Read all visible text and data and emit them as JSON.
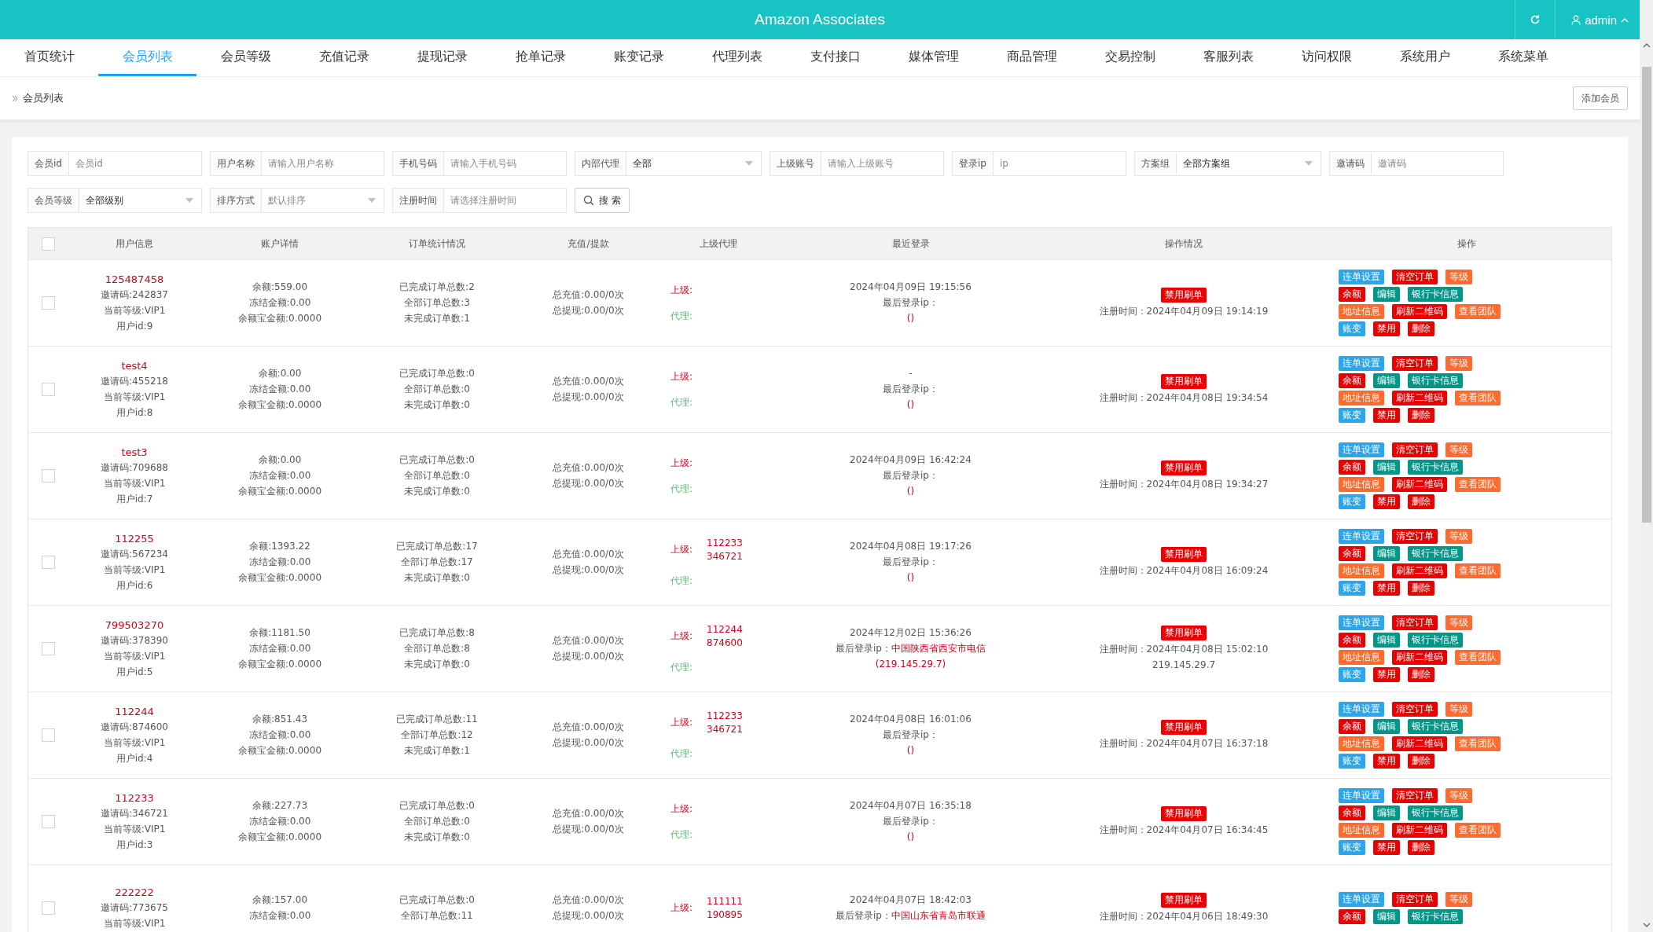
{
  "header": {
    "title": "Amazon Associates",
    "user": "admin"
  },
  "tabs": [
    {
      "label": "首页统计",
      "selected": false
    },
    {
      "label": "会员列表",
      "selected": true
    },
    {
      "label": "会员等级",
      "selected": false
    },
    {
      "label": "充值记录",
      "selected": false
    },
    {
      "label": "提现记录",
      "selected": false
    },
    {
      "label": "抢单记录",
      "selected": false
    },
    {
      "label": "账变记录",
      "selected": false
    },
    {
      "label": "代理列表",
      "selected": false
    },
    {
      "label": "支付接口",
      "selected": false
    },
    {
      "label": "媒体管理",
      "selected": false
    },
    {
      "label": "商品管理",
      "selected": false
    },
    {
      "label": "交易控制",
      "selected": false
    },
    {
      "label": "客服列表",
      "selected": false
    },
    {
      "label": "访问权限",
      "selected": false
    },
    {
      "label": "系统用户",
      "selected": false
    },
    {
      "label": "系统菜单",
      "selected": false
    }
  ],
  "breadcrumb": "会员列表",
  "add_button": "添加会员",
  "filters": [
    {
      "label": "会员id",
      "kind": "input",
      "placeholder": "会员id"
    },
    {
      "label": "用户名称",
      "kind": "input",
      "placeholder": "请输入用户名称"
    },
    {
      "label": "手机号码",
      "kind": "input",
      "placeholder": "请输入手机号码"
    },
    {
      "label": "内部代理",
      "kind": "select",
      "value": "全部"
    },
    {
      "label": "上级账号",
      "kind": "input",
      "placeholder": "请输入上级账号"
    },
    {
      "label": "登录ip",
      "kind": "input",
      "placeholder": "ip"
    },
    {
      "label": "方案组",
      "kind": "select",
      "value": "全部方案组"
    },
    {
      "label": "邀请码",
      "kind": "input",
      "placeholder": "邀请码"
    },
    {
      "label": "会员等级",
      "kind": "select",
      "value": "全部级别"
    },
    {
      "label": "排序方式",
      "kind": "select",
      "placeholder": "默认排序"
    },
    {
      "label": "注册时间",
      "kind": "input",
      "placeholder": "请选择注册时间"
    }
  ],
  "search_button": "搜 索",
  "table": {
    "all_checked": false,
    "columns": [
      "用户信息",
      "账户详情",
      "订单统计情况",
      "充值/提款",
      "上级代理",
      "最近登录",
      "操作情况",
      "操作"
    ],
    "rows": [
      {
        "checked": false,
        "name": "125487458",
        "user_lines": [
          "邀请码:242837",
          "当前等级:VIP1",
          "用户id:9"
        ],
        "account": [
          "余额:559.00",
          "冻结金额:0.00",
          "余额宝金额:0.0000"
        ],
        "orders": [
          "已完成订单总数:2",
          "全部订单总数:3",
          "未完成订单数:1"
        ],
        "funds": [
          "总充值:0.00/0次",
          "总提现:0.00/0次"
        ],
        "superior_label": "上级:",
        "superiors": [],
        "agent_label": "代理:",
        "login_time": "2024年04月09日 19:15:56",
        "ip_label": "最后登录ip：",
        "ip": "()",
        "op_button": "禁用刷单",
        "reg_time": "注册时间：2024年04月09日 19:14:19",
        "actions": [
          [
            {
              "label": "连单设置",
              "kind": "info"
            },
            {
              "label": "清空订单",
              "kind": "danger"
            },
            {
              "label": "等级",
              "kind": "warning"
            }
          ],
          [
            {
              "label": "余额",
              "kind": "danger"
            },
            {
              "label": "编辑",
              "kind": "primary"
            },
            {
              "label": "银行卡信息",
              "kind": "primary"
            }
          ],
          [
            {
              "label": "地址信息",
              "kind": "warning"
            },
            {
              "label": "刷新二维码",
              "kind": "danger"
            },
            {
              "label": "查看团队",
              "kind": "warning"
            }
          ],
          [
            {
              "label": "账变",
              "kind": "info"
            },
            {
              "label": "禁用",
              "kind": "danger"
            },
            {
              "label": "删除",
              "kind": "danger"
            }
          ]
        ]
      },
      {
        "checked": false,
        "name": "test4",
        "user_lines": [
          "邀请码:455218",
          "当前等级:VIP1",
          "用户id:8"
        ],
        "account": [
          "余额:0.00",
          "冻结金额:0.00",
          "余额宝金额:0.0000"
        ],
        "orders": [
          "已完成订单总数:0",
          "全部订单总数:0",
          "未完成订单数:0"
        ],
        "funds": [
          "总充值:0.00/0次",
          "总提现:0.00/0次"
        ],
        "superior_label": "上级:",
        "superiors": [],
        "agent_label": "代理:",
        "login_time": "-",
        "ip_label": "最后登录ip：",
        "ip": "()",
        "op_button": "禁用刷单",
        "reg_time": "注册时间：2024年04月08日 19:34:54",
        "actions": [
          [
            {
              "label": "连单设置",
              "kind": "info"
            },
            {
              "label": "清空订单",
              "kind": "danger"
            },
            {
              "label": "等级",
              "kind": "warning"
            }
          ],
          [
            {
              "label": "余额",
              "kind": "danger"
            },
            {
              "label": "编辑",
              "kind": "primary"
            },
            {
              "label": "银行卡信息",
              "kind": "primary"
            }
          ],
          [
            {
              "label": "地址信息",
              "kind": "warning"
            },
            {
              "label": "刷新二维码",
              "kind": "danger"
            },
            {
              "label": "查看团队",
              "kind": "warning"
            }
          ],
          [
            {
              "label": "账变",
              "kind": "info"
            },
            {
              "label": "禁用",
              "kind": "danger"
            },
            {
              "label": "删除",
              "kind": "danger"
            }
          ]
        ]
      },
      {
        "checked": false,
        "name": "test3",
        "user_lines": [
          "邀请码:709688",
          "当前等级:VIP1",
          "用户id:7"
        ],
        "account": [
          "余额:0.00",
          "冻结金额:0.00",
          "余额宝金额:0.0000"
        ],
        "orders": [
          "已完成订单总数:0",
          "全部订单总数:0",
          "未完成订单数:0"
        ],
        "funds": [
          "总充值:0.00/0次",
          "总提现:0.00/0次"
        ],
        "superior_label": "上级:",
        "superiors": [],
        "agent_label": "代理:",
        "login_time": "2024年04月09日 16:42:24",
        "ip_label": "最后登录ip：",
        "ip": "()",
        "op_button": "禁用刷单",
        "reg_time": "注册时间：2024年04月08日 19:34:27",
        "actions": [
          [
            {
              "label": "连单设置",
              "kind": "info"
            },
            {
              "label": "清空订单",
              "kind": "danger"
            },
            {
              "label": "等级",
              "kind": "warning"
            }
          ],
          [
            {
              "label": "余额",
              "kind": "danger"
            },
            {
              "label": "编辑",
              "kind": "primary"
            },
            {
              "label": "银行卡信息",
              "kind": "primary"
            }
          ],
          [
            {
              "label": "地址信息",
              "kind": "warning"
            },
            {
              "label": "刷新二维码",
              "kind": "danger"
            },
            {
              "label": "查看团队",
              "kind": "warning"
            }
          ],
          [
            {
              "label": "账变",
              "kind": "info"
            },
            {
              "label": "禁用",
              "kind": "danger"
            },
            {
              "label": "删除",
              "kind": "danger"
            }
          ]
        ]
      },
      {
        "checked": false,
        "name": "112255",
        "user_lines": [
          "邀请码:567234",
          "当前等级:VIP1",
          "用户id:6"
        ],
        "account": [
          "余额:1393.22",
          "冻结金额:0.00",
          "余额宝金额:0.0000"
        ],
        "orders": [
          "已完成订单总数:17",
          "全部订单总数:17",
          "未完成订单数:0"
        ],
        "funds": [
          "总充值:0.00/0次",
          "总提现:0.00/0次"
        ],
        "superior_label": "上级:",
        "superiors": [
          "112233",
          "346721"
        ],
        "agent_label": "代理:",
        "login_time": "2024年04月08日 19:17:26",
        "ip_label": "最后登录ip：",
        "ip": "()",
        "op_button": "禁用刷单",
        "reg_time": "注册时间：2024年04月08日 16:09:24",
        "actions": [
          [
            {
              "label": "连单设置",
              "kind": "info"
            },
            {
              "label": "清空订单",
              "kind": "danger"
            },
            {
              "label": "等级",
              "kind": "warning"
            }
          ],
          [
            {
              "label": "余额",
              "kind": "danger"
            },
            {
              "label": "编辑",
              "kind": "primary"
            },
            {
              "label": "银行卡信息",
              "kind": "primary"
            }
          ],
          [
            {
              "label": "地址信息",
              "kind": "warning"
            },
            {
              "label": "刷新二维码",
              "kind": "danger"
            },
            {
              "label": "查看团队",
              "kind": "warning"
            }
          ],
          [
            {
              "label": "账变",
              "kind": "info"
            },
            {
              "label": "禁用",
              "kind": "danger"
            },
            {
              "label": "删除",
              "kind": "danger"
            }
          ]
        ]
      },
      {
        "checked": false,
        "name": "799503270",
        "user_lines": [
          "邀请码:378390",
          "当前等级:VIP1",
          "用户id:5"
        ],
        "account": [
          "余额:1181.50",
          "冻结金额:0.00",
          "余额宝金额:0.0000"
        ],
        "orders": [
          "已完成订单总数:8",
          "全部订单总数:8",
          "未完成订单数:0"
        ],
        "funds": [
          "总充值:0.00/0次",
          "总提现:0.00/0次"
        ],
        "superior_label": "上级:",
        "superiors": [
          "112244",
          "874600"
        ],
        "agent_label": "代理:",
        "login_time": "2024年12月02日 15:36:26",
        "ip_label": "最后登录ip：",
        "ip_location": "中国陕西省西安市电信",
        "ip": "(219.145.29.7)",
        "op_button": "禁用刷单",
        "reg_time": "注册时间：2024年04月08日 15:02:10",
        "reg_ip": "219.145.29.7",
        "actions": [
          [
            {
              "label": "连单设置",
              "kind": "info"
            },
            {
              "label": "清空订单",
              "kind": "danger"
            },
            {
              "label": "等级",
              "kind": "warning"
            }
          ],
          [
            {
              "label": "余额",
              "kind": "danger"
            },
            {
              "label": "编辑",
              "kind": "primary"
            },
            {
              "label": "银行卡信息",
              "kind": "primary"
            }
          ],
          [
            {
              "label": "地址信息",
              "kind": "warning"
            },
            {
              "label": "刷新二维码",
              "kind": "danger"
            },
            {
              "label": "查看团队",
              "kind": "warning"
            }
          ],
          [
            {
              "label": "账变",
              "kind": "info"
            },
            {
              "label": "禁用",
              "kind": "danger"
            },
            {
              "label": "删除",
              "kind": "danger"
            }
          ]
        ]
      },
      {
        "checked": false,
        "name": "112244",
        "user_lines": [
          "邀请码:874600",
          "当前等级:VIP1",
          "用户id:4"
        ],
        "account": [
          "余额:851.43",
          "冻结金额:0.00",
          "余额宝金额:0.0000"
        ],
        "orders": [
          "已完成订单总数:11",
          "全部订单总数:12",
          "未完成订单数:1"
        ],
        "funds": [
          "总充值:0.00/0次",
          "总提现:0.00/0次"
        ],
        "superior_label": "上级:",
        "superiors": [
          "112233",
          "346721"
        ],
        "agent_label": "代理:",
        "login_time": "2024年04月08日 16:01:06",
        "ip_label": "最后登录ip：",
        "ip": "()",
        "op_button": "禁用刷单",
        "reg_time": "注册时间：2024年04月07日 16:37:18",
        "actions": [
          [
            {
              "label": "连单设置",
              "kind": "info"
            },
            {
              "label": "清空订单",
              "kind": "danger"
            },
            {
              "label": "等级",
              "kind": "warning"
            }
          ],
          [
            {
              "label": "余额",
              "kind": "danger"
            },
            {
              "label": "编辑",
              "kind": "primary"
            },
            {
              "label": "银行卡信息",
              "kind": "primary"
            }
          ],
          [
            {
              "label": "地址信息",
              "kind": "warning"
            },
            {
              "label": "刷新二维码",
              "kind": "danger"
            },
            {
              "label": "查看团队",
              "kind": "warning"
            }
          ],
          [
            {
              "label": "账变",
              "kind": "info"
            },
            {
              "label": "禁用",
              "kind": "danger"
            },
            {
              "label": "删除",
              "kind": "danger"
            }
          ]
        ]
      },
      {
        "checked": false,
        "name": "112233",
        "user_lines": [
          "邀请码:346721",
          "当前等级:VIP1",
          "用户id:3"
        ],
        "account": [
          "余额:227.73",
          "冻结金额:0.00",
          "余额宝金额:0.0000"
        ],
        "orders": [
          "已完成订单总数:0",
          "全部订单总数:0",
          "未完成订单数:0"
        ],
        "funds": [
          "总充值:0.00/0次",
          "总提现:0.00/0次"
        ],
        "superior_label": "上级:",
        "superiors": [],
        "agent_label": "代理:",
        "login_time": "2024年04月07日 16:35:18",
        "ip_label": "最后登录ip：",
        "ip": "()",
        "op_button": "禁用刷单",
        "reg_time": "注册时间：2024年04月07日 16:34:45",
        "actions": [
          [
            {
              "label": "连单设置",
              "kind": "info"
            },
            {
              "label": "清空订单",
              "kind": "danger"
            },
            {
              "label": "等级",
              "kind": "warning"
            }
          ],
          [
            {
              "label": "余额",
              "kind": "danger"
            },
            {
              "label": "编辑",
              "kind": "primary"
            },
            {
              "label": "银行卡信息",
              "kind": "primary"
            }
          ],
          [
            {
              "label": "地址信息",
              "kind": "warning"
            },
            {
              "label": "刷新二维码",
              "kind": "danger"
            },
            {
              "label": "查看团队",
              "kind": "warning"
            }
          ],
          [
            {
              "label": "账变",
              "kind": "info"
            },
            {
              "label": "禁用",
              "kind": "danger"
            },
            {
              "label": "删除",
              "kind": "danger"
            }
          ]
        ]
      },
      {
        "checked": false,
        "name": "222222",
        "user_lines": [
          "邀请码:773675",
          "当前等级:VIP1"
        ],
        "account": [
          "余额:157.00",
          "冻结金额:0.00"
        ],
        "orders": [
          "已完成订单总数:0",
          "全部订单总数:11"
        ],
        "funds": [
          "总充值:0.00/0次",
          "总提现:0.00/0次"
        ],
        "superior_label": "上级:",
        "superiors": [
          "111111",
          "190895"
        ],
        "login_time": "2024年04月07日 18:42:03",
        "ip_label": "最后登录ip：",
        "ip_location": "中国山东省青岛市联通",
        "op_button": "禁用刷单",
        "reg_time": "注册时间：2024年04月06日 18:49:30",
        "actions": [
          [
            {
              "label": "连单设置",
              "kind": "info"
            },
            {
              "label": "清空订单",
              "kind": "danger"
            },
            {
              "label": "等级",
              "kind": "warning"
            }
          ],
          [
            {
              "label": "余额",
              "kind": "danger"
            },
            {
              "label": "编辑",
              "kind": "primary"
            },
            {
              "label": "银行卡信息",
              "kind": "primary"
            }
          ]
        ]
      }
    ]
  }
}
